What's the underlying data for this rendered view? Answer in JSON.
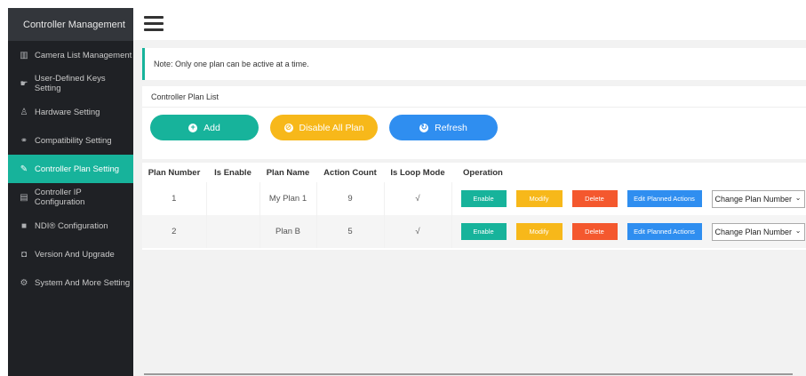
{
  "sidebar": {
    "title": "Controller Management",
    "items": [
      {
        "label": "Camera List Management",
        "icon": "▥"
      },
      {
        "label": "User-Defined Keys Setting",
        "icon": "☛"
      },
      {
        "label": "Hardware Setting",
        "icon": "♙"
      },
      {
        "label": "Compatibility Setting",
        "icon": "⚭"
      },
      {
        "label": "Controller Plan Setting",
        "icon": "✎"
      },
      {
        "label": "Controller IP Configuration",
        "icon": "▤"
      },
      {
        "label": "NDI® Configuration",
        "icon": "■"
      },
      {
        "label": "Version And Upgrade",
        "icon": "◘"
      },
      {
        "label": "System And More Setting",
        "icon": "⚙"
      }
    ]
  },
  "note": "Note: Only one plan can be active at a time.",
  "plan_list": {
    "title": "Controller Plan List",
    "add_label": "Add",
    "add_icon": "+",
    "disable_all_label": "Disable All Plan",
    "disable_icon": "⊘",
    "refresh_label": "Refresh",
    "refresh_icon": "↻"
  },
  "table": {
    "headers": {
      "plan_number": "Plan Number",
      "is_enable": "Is Enable",
      "plan_name": "Plan Name",
      "action_count": "Action Count",
      "is_loop_mode": "Is Loop Mode",
      "operation": "Operation"
    },
    "rows": [
      {
        "plan_number": "1",
        "is_enable": "",
        "plan_name": "My Plan 1",
        "action_count": "9",
        "is_loop_mode": "√"
      },
      {
        "plan_number": "2",
        "is_enable": "",
        "plan_name": "Plan B",
        "action_count": "5",
        "is_loop_mode": "√"
      }
    ],
    "ops": {
      "enable": "Enable",
      "modify": "Modify",
      "delete": "Delete",
      "edit": "Edit Planned Actions",
      "change_plan": "Change Plan Number"
    }
  },
  "colors": {
    "accent": "#17b39b",
    "warning": "#f7b81a",
    "danger": "#f4582e",
    "primary": "#2f8ef0",
    "sidebar_bg": "#1f2125"
  }
}
